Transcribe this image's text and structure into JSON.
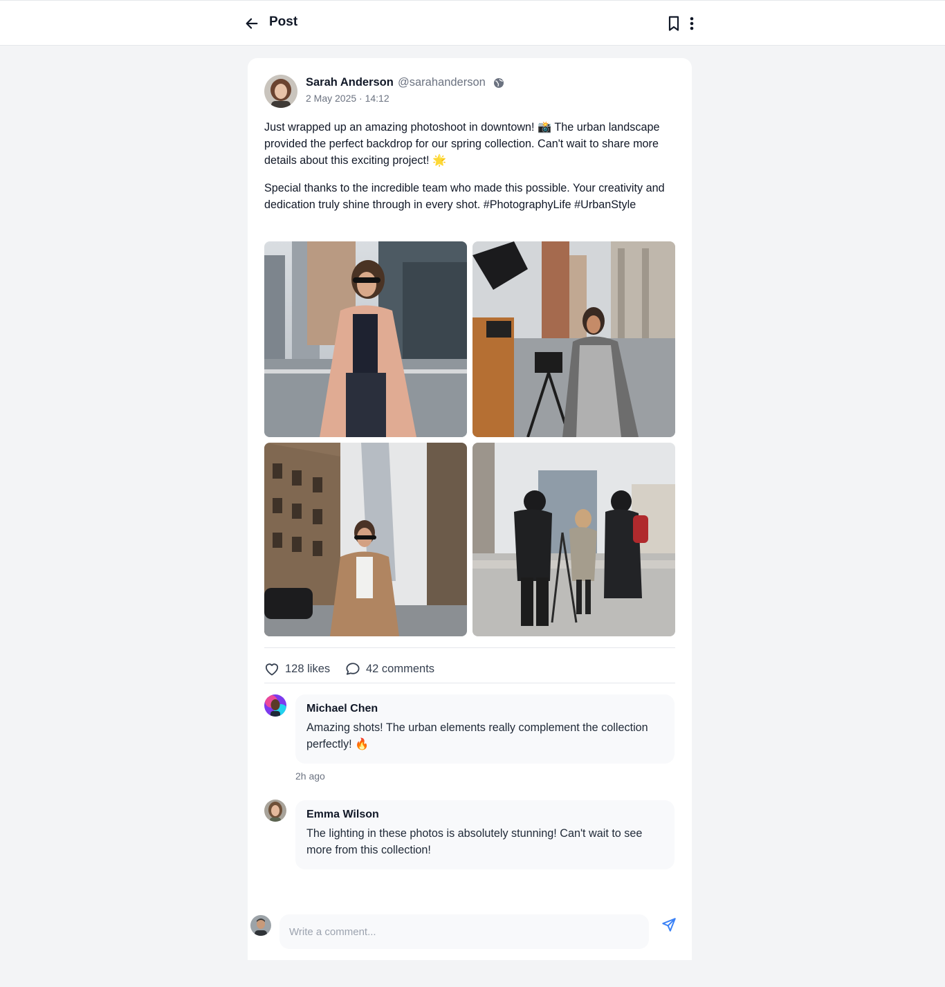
{
  "header": {
    "title": "Post",
    "back_icon": "arrow-left-icon",
    "bookmark_icon": "bookmark-icon",
    "more_icon": "more-vertical-icon"
  },
  "post": {
    "author": {
      "name": "Sarah Anderson",
      "handle": "@sarahanderson",
      "visibility_icon": "globe-icon"
    },
    "date": "2 May 2025 · 14:12",
    "paragraphs": [
      "Just wrapped up an amazing photoshoot in downtown! 📸 The urban landscape provided the perfect backdrop for our spring collection. Can't wait to share more details about this exciting project! 🌟",
      "Special thanks to the incredible team who made this possible. Your creativity and dedication truly shine through in every shot. #PhotographyLife #UrbanStyle"
    ],
    "photo_count": 4,
    "stats": {
      "likes": "128 likes",
      "comments": "42 comments"
    }
  },
  "comments": [
    {
      "name": "Michael Chen",
      "text": "Amazing shots! The urban elements really complement the collection perfectly! 🔥",
      "time": "2h ago"
    },
    {
      "name": "Emma Wilson",
      "text": "The lighting in these photos is absolutely stunning! Can't wait to see more from this collection!"
    }
  ],
  "composer": {
    "placeholder": "Write a comment...",
    "send_icon": "send-icon"
  },
  "colors": {
    "page_background": "#f3f4f6",
    "card_background": "#ffffff",
    "text_primary": "#111827",
    "text_secondary": "#6b7280",
    "accent_send": "#3b82f6",
    "comment_bubble": "#f8f9fb"
  }
}
